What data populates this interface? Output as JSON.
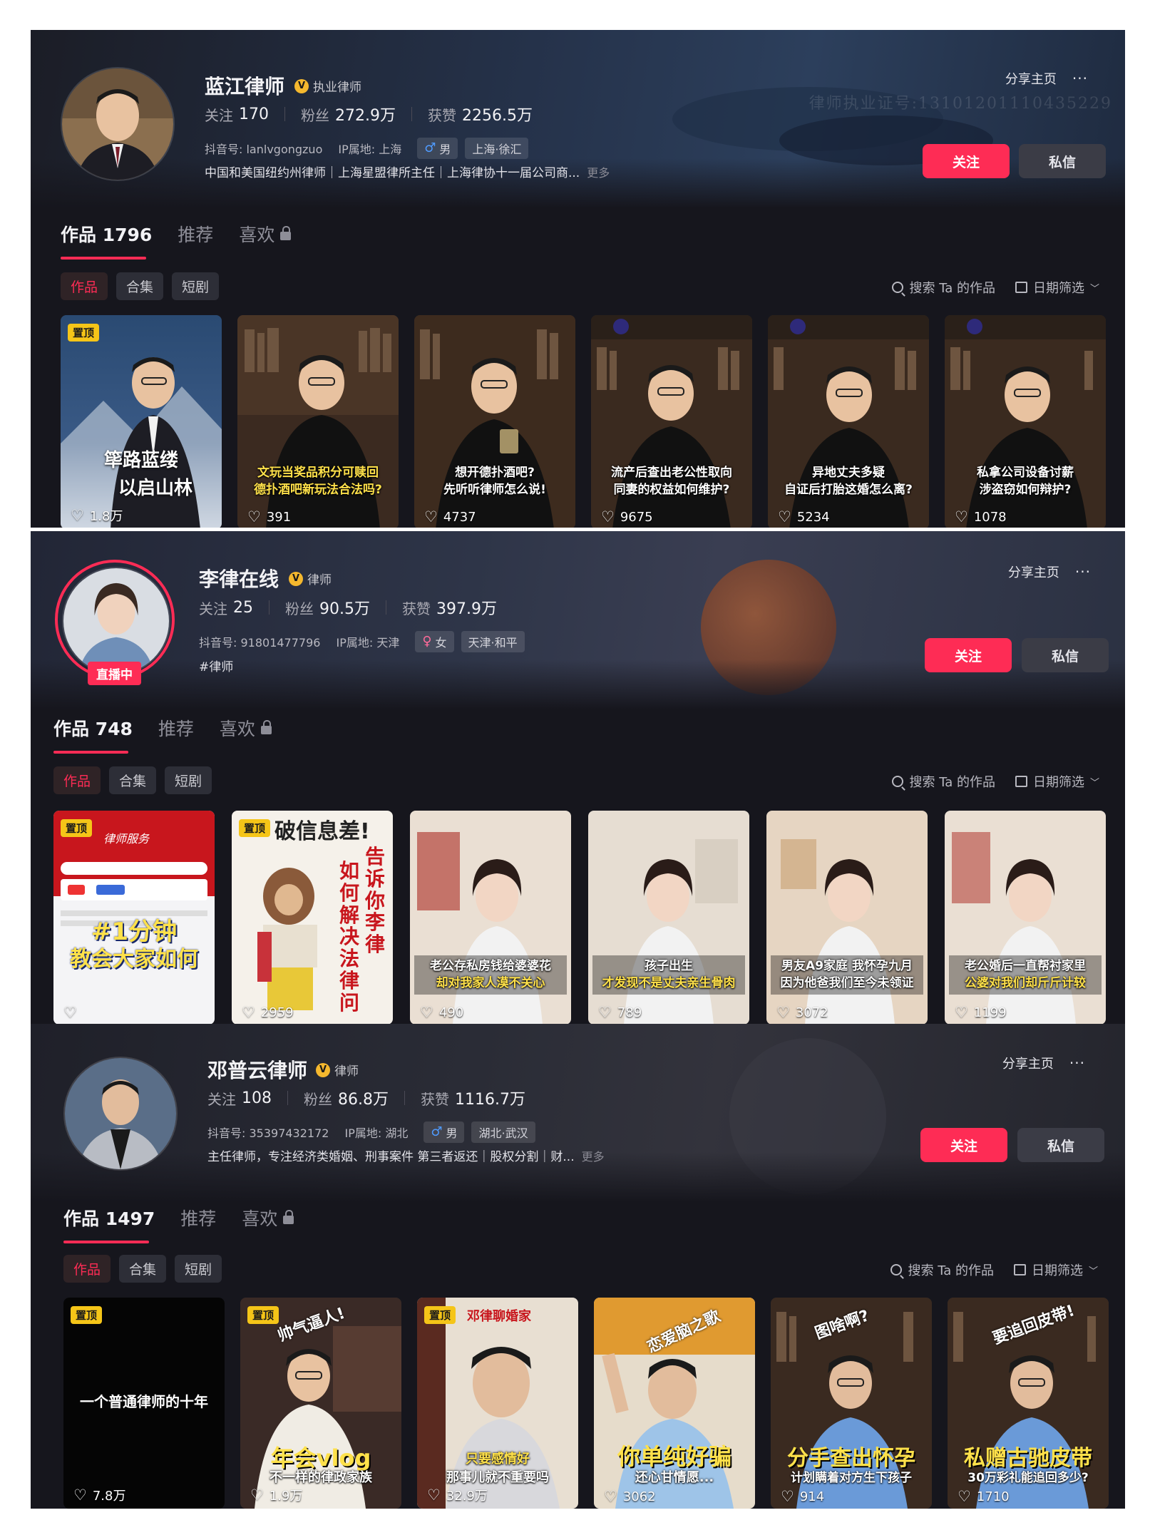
{
  "profiles": [
    {
      "name": "蓝江律师",
      "verified_label": "执业律师",
      "follow_label": "关注",
      "follow_count": "170",
      "fans_label": "粉丝",
      "fans_count": "272.9万",
      "likes_label": "获赞",
      "likes_count": "2256.5万",
      "douyin_id": "抖音号: lanlvgongzuo",
      "ip": "IP属地: 上海",
      "gender": "男",
      "location": "上海·徐汇",
      "bio": "中国和美国纽约州律师｜上海星盟律所主任｜上海律协十一届公司商...",
      "bio_more": "更多",
      "watermark": "律师执业证号:13101201110435229",
      "share": "分享主页",
      "follow_btn": "关注",
      "message_btn": "私信",
      "tabs": {
        "works": "作品 1796",
        "recommend": "推荐",
        "liked": "喜欢"
      },
      "subtabs": [
        "作品",
        "合集",
        "短剧"
      ],
      "search": "搜索 Ta 的作品",
      "date_filter": "日期筛选",
      "videos": [
        {
          "pinned": "置顶",
          "caption_a": "筚路蓝缕",
          "caption_b": "以启山林",
          "likes": "1.8万"
        },
        {
          "caption_a": "文玩当奖品积分可赎回",
          "caption_b": "德扑酒吧新玩法合法吗?",
          "likes": "391"
        },
        {
          "caption_a": "想开德扑酒吧?",
          "caption_b": "先听听律师怎么说!",
          "likes": "4737"
        },
        {
          "caption_a": "流产后查出老公性取向",
          "caption_b": "同妻的权益如何维护?",
          "likes": "9675"
        },
        {
          "caption_a": "异地丈夫多疑",
          "caption_b": "自证后打胎这婚怎么离?",
          "likes": "5234"
        },
        {
          "caption_a": "私拿公司设备讨薪",
          "caption_b": "涉盗窃如何辩护?",
          "likes": "1078"
        }
      ]
    },
    {
      "name": "李律在线",
      "verified_label": "律师",
      "live_label": "直播中",
      "follow_label": "关注",
      "follow_count": "25",
      "fans_label": "粉丝",
      "fans_count": "90.5万",
      "likes_label": "获赞",
      "likes_count": "397.9万",
      "douyin_id": "抖音号: 91801477796",
      "ip": "IP属地: 天津",
      "gender": "女",
      "location": "天津·和平",
      "bio": "#律师",
      "share": "分享主页",
      "follow_btn": "关注",
      "message_btn": "私信",
      "tabs": {
        "works": "作品 748",
        "recommend": "推荐",
        "liked": "喜欢"
      },
      "subtabs": [
        "作品",
        "合集",
        "短剧"
      ],
      "search": "搜索 Ta 的作品",
      "date_filter": "日期筛选",
      "videos": [
        {
          "pinned": "置顶",
          "header": "律师服务",
          "caption_a": "#1分钟",
          "caption_b": "教会大家如何",
          "likes": ""
        },
        {
          "pinned": "置顶",
          "header": "破信息差!",
          "caption_a": "告诉你李律",
          "caption_b": "如何解决法律问",
          "likes": "2959"
        },
        {
          "caption_a": "老公存私房钱给婆婆花",
          "caption_b": "却对我家人漠不关心",
          "likes": "490"
        },
        {
          "caption_a": "孩子出生",
          "caption_b": "才发现不是丈夫亲生骨肉",
          "likes": "789"
        },
        {
          "caption_a": "男友A9家庭 我怀孕九月",
          "caption_b": "因为他爸我们至今未领证",
          "likes": "3072"
        },
        {
          "caption_a": "老公婚后一直帮衬家里",
          "caption_b": "公婆对我们却斤斤计较",
          "likes": "1199"
        }
      ]
    },
    {
      "name": "邓普云律师",
      "verified_label": "律师",
      "follow_label": "关注",
      "follow_count": "108",
      "fans_label": "粉丝",
      "fans_count": "86.8万",
      "likes_label": "获赞",
      "likes_count": "1116.7万",
      "douyin_id": "抖音号: 35397432172",
      "ip": "IP属地: 湖北",
      "gender": "男",
      "location": "湖北·武汉",
      "bio": "主任律师，专注经济类婚姻、刑事案件 第三者返还｜股权分割｜财...",
      "bio_more": "更多",
      "share": "分享主页",
      "follow_btn": "关注",
      "message_btn": "私信",
      "tabs": {
        "works": "作品 1497",
        "recommend": "推荐",
        "liked": "喜欢"
      },
      "subtabs": [
        "作品",
        "合集",
        "短剧"
      ],
      "search": "搜索 Ta 的作品",
      "date_filter": "日期筛选",
      "videos": [
        {
          "pinned": "置顶",
          "caption_a": "一个普通律师的十年",
          "caption_b": "",
          "likes": "7.8万"
        },
        {
          "pinned": "置顶",
          "header": "帅气逼人!",
          "caption_a": "年会vlog",
          "caption_b": "不一样的律政家族",
          "likes": "1.9万"
        },
        {
          "pinned": "置顶",
          "header": "邓律聊婚家",
          "caption_a": "只要感情好",
          "caption_b": "那事儿就不重要吗",
          "likes": "32.9万"
        },
        {
          "header": "恋爱脑之歌",
          "caption_a": "你单纯好骗",
          "caption_b": "还心甘情愿...",
          "likes": "3062"
        },
        {
          "header": "图啥啊?",
          "caption_a": "分手查出怀孕",
          "caption_b": "计划瞒着对方生下孩子",
          "likes": "914"
        },
        {
          "header": "要追回皮带!",
          "caption_a": "私赠古驰皮带",
          "caption_b": "30万彩礼能追回多少?",
          "likes": "1710"
        }
      ]
    }
  ]
}
